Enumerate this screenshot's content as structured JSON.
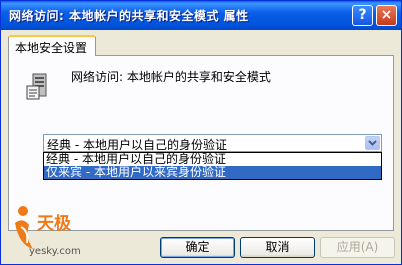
{
  "window": {
    "title": "网络访问: 本地帐户的共享和安全模式 属性",
    "help_glyph": "?",
    "close_glyph": "×"
  },
  "tabs": [
    {
      "label": "本地安全设置",
      "active": true
    }
  ],
  "policy": {
    "name": "网络访问: 本地帐户的共享和安全模式",
    "icon": "policy-server-icon"
  },
  "select": {
    "value": "经典 - 本地用户以自己的身份验证",
    "options": [
      "经典 - 本地用户以自己的身份验证",
      "仅来宾 - 本地用户以来宾身份验证"
    ],
    "highlighted_index": 1
  },
  "buttons": {
    "ok": "确定",
    "cancel": "取消",
    "apply": "应用(A)"
  },
  "watermark": {
    "brand": "天极",
    "site": "yesky.com"
  },
  "colors": {
    "titlebar": "#0a5ee8",
    "selection": "#316ac5",
    "tab_accent": "#ffc83c",
    "logo": "#f07a18"
  }
}
